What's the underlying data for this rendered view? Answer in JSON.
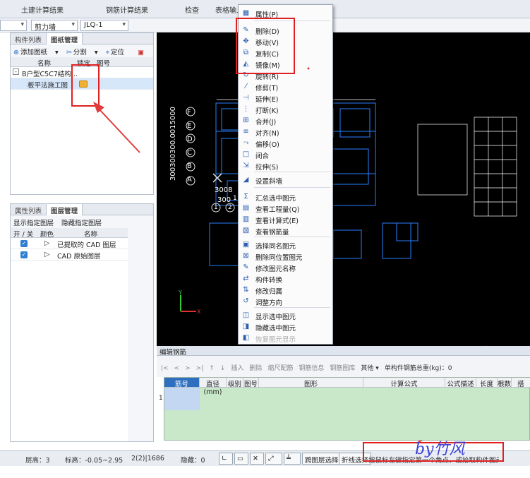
{
  "top": {
    "t1": "土建计算结果",
    "t2": "钢筋计算结果",
    "t3": "检查",
    "t4": "表格输入"
  },
  "selectors": {
    "s2": "剪力墙",
    "s3": "JLQ-1"
  },
  "upper_panel": {
    "tab1": "构件列表",
    "tab2": "图纸管理",
    "toolbar": {
      "add": "添加图纸",
      "split": "分割",
      "locate": "定位",
      "delete": "删除"
    },
    "cols": {
      "name": "名称",
      "lock": "锁定",
      "num": "图号"
    },
    "rows": [
      {
        "prefix": "-",
        "name": "B户型C5C7结构..."
      },
      {
        "name": "板平法施工图"
      }
    ]
  },
  "lower_panel": {
    "tab1": "属性列表",
    "tab2": "图层管理",
    "opt1": "显示指定图层",
    "opt2": "隐藏指定图层",
    "cols": {
      "onoff": "开 / 关",
      "color": "颜色",
      "name": "名称"
    },
    "rows": [
      {
        "arrow": "▷",
        "name": "已提取的 CAD 图层"
      },
      {
        "arrow": "▷",
        "name": "CAD 原始图层"
      }
    ]
  },
  "canvas": {
    "axis_letters": [
      "F",
      "E",
      "D",
      "C",
      "B",
      "A"
    ],
    "vert_dim": "300300300.0015000",
    "dims": [
      "3008",
      "300"
    ],
    "axis_numbers": [
      "1",
      "2",
      "1"
    ],
    "axis_x": "X",
    "axis_y": "Y"
  },
  "context_menu": {
    "items": [
      {
        "icon": "▦",
        "label": "属性(P)"
      },
      {
        "icon": "✎",
        "label": "删除(D)"
      },
      {
        "icon": "✥",
        "label": "移动(V)"
      },
      {
        "icon": "⧉",
        "label": "复制(C)"
      },
      {
        "icon": "◭",
        "label": "镜像(M)"
      },
      {
        "icon": "↻",
        "label": "旋转(R)"
      },
      {
        "icon": "⁄",
        "label": "修剪(T)"
      },
      {
        "icon": "⊣",
        "label": "延伸(E)"
      },
      {
        "icon": "⋮",
        "label": "打断(K)"
      },
      {
        "icon": "⊞",
        "label": "合并(J)"
      },
      {
        "icon": "≡",
        "label": "对齐(N)"
      },
      {
        "icon": "⤳",
        "label": "偏移(O)"
      },
      {
        "icon": "□",
        "label": "闭合"
      },
      {
        "icon": "⇲",
        "label": "拉伸(S)"
      },
      {
        "icon": "◢",
        "label": "设置斜墙"
      },
      {
        "icon": "Σ",
        "label": "汇总选中图元"
      },
      {
        "icon": "▤",
        "label": "查看工程量(Q)"
      },
      {
        "icon": "▥",
        "label": "查看计算式(E)"
      },
      {
        "icon": "▧",
        "label": "查看钢筋量"
      },
      {
        "icon": "▣",
        "label": "选择同名图元"
      },
      {
        "icon": "⊠",
        "label": "删除同位置图元"
      },
      {
        "icon": "✎",
        "label": "修改图元名称"
      },
      {
        "icon": "⇄",
        "label": "构件转换"
      },
      {
        "icon": "⇅",
        "label": "修改归属"
      },
      {
        "icon": "↺",
        "label": "调整方向"
      },
      {
        "icon": "◫",
        "label": "显示选中图元"
      },
      {
        "icon": "◨",
        "label": "隐藏选中图元"
      },
      {
        "icon": "◧",
        "label": "恢复图元显示"
      }
    ]
  },
  "edit_panel": {
    "title": "编辑钢筋",
    "toolbar": [
      "|<",
      "<",
      ">",
      ">|",
      "↑",
      "↓",
      "插入",
      "删除",
      "缩尺配筋",
      "钢筋信息",
      "钢筋图库",
      "其他 ▾",
      "单构件钢筋总重(kg)：0"
    ],
    "columns": [
      "筋号",
      "直径(mm)",
      "级别",
      "图号",
      "图形",
      "计算公式",
      "公式描述",
      "长度",
      "根数",
      "搭"
    ],
    "row_num": "1"
  },
  "status": {
    "floor": "层高：3",
    "elev": "标高：-0.05~2.95",
    "sel": "2(2)|1686",
    "hide": "隐藏：0",
    "btn1": "跨图层选择",
    "btn2": "折线选择",
    "btn3": "按鼠标左键指定第一个角点，或拾取构件图元",
    "watermark": "by竹风"
  }
}
